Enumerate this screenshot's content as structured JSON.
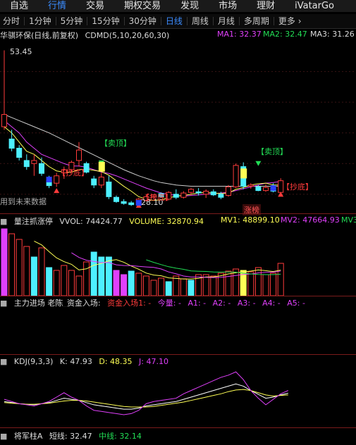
{
  "nav": {
    "items": [
      "自选",
      "行情",
      "交易",
      "期权交易",
      "发现",
      "市场",
      "理财",
      "iVatarGo"
    ],
    "active": 1
  },
  "period_tabs": {
    "items": [
      "分时",
      "1分钟",
      "5分钟",
      "15分钟",
      "30分钟",
      "日线",
      "周线",
      "月线",
      "多周期",
      "更多 ›"
    ],
    "active": 5
  },
  "main": {
    "stock": "华骐环保(日线,前复权)",
    "indicator": "CDMD(5,10,20,60,30)",
    "ma1": "MA1: 32.37",
    "ma2": "MA2: 32.47",
    "ma3": "MA3: 31.26",
    "high_label": "53.45",
    "low_label": "28.10",
    "sell_label": "【卖顶】",
    "buy_label": "【抄底】",
    "future_note": "用到未来数据",
    "limit_up": "涨榜"
  },
  "vol": {
    "title": "量注抓涨停",
    "vvol": "VVOL: 74424.77",
    "volume": "VOLUME: 32870.94",
    "mv1": "MV1: 48899.10",
    "mv2": "MV2: 47664.93",
    "mv3": "MV3"
  },
  "fund": {
    "title": "主力进场 老陈_资金入场:",
    "entry": "资金入场1: -",
    "today": "今量: -",
    "a1": "A1: -",
    "a2": "A2: -",
    "a3": "A3: -",
    "a4": "A4: -",
    "a5": "A5: -"
  },
  "kdj": {
    "title": "KDJ(9,3,3)",
    "k": "K: 47.93",
    "d": "D: 48.35",
    "j": "J: 47.10"
  },
  "general": {
    "title": "将军柱A",
    "short": "短线: 32.47",
    "mid": "中线: 32.14"
  },
  "colors": {
    "up": "#ff3b3b",
    "down": "#4df0ff",
    "magenta": "#e040fb",
    "yellow": "#ffff55",
    "green": "#22dd55",
    "blue_active": "#3b8cff"
  },
  "chart_data": [
    {
      "type": "candlestick",
      "title": "华骐环保(日线,前复权)",
      "candles": [
        {
          "o": 41,
          "h": 53.45,
          "l": 40.5,
          "c": 43
        },
        {
          "o": 39,
          "h": 40.5,
          "l": 37,
          "c": 37.5
        },
        {
          "o": 37.5,
          "h": 38,
          "l": 35.5,
          "c": 36
        },
        {
          "o": 35.5,
          "h": 36.5,
          "l": 34,
          "c": 34.5
        },
        {
          "o": 35,
          "h": 36.5,
          "l": 33,
          "c": 35.5
        },
        {
          "o": 35,
          "h": 36,
          "l": 33,
          "c": 33.4
        },
        {
          "o": 32.2,
          "h": 33,
          "l": 31,
          "c": 31.4
        },
        {
          "o": 31.8,
          "h": 33.5,
          "l": 31.2,
          "c": 33
        },
        {
          "o": 33.5,
          "h": 34.5,
          "l": 32.5,
          "c": 34
        },
        {
          "o": 34,
          "h": 35.5,
          "l": 33.5,
          "c": 35.2
        },
        {
          "o": 35.5,
          "h": 38.5,
          "l": 34.5,
          "c": 37.2
        },
        {
          "o": 35,
          "h": 35.3,
          "l": 33.4,
          "c": 33.6
        },
        {
          "o": 32.5,
          "h": 33,
          "l": 31,
          "c": 31.5
        },
        {
          "o": 31.5,
          "h": 33.5,
          "l": 31,
          "c": 32.8
        },
        {
          "o": 32,
          "h": 33,
          "l": 29.2,
          "c": 29.6
        },
        {
          "o": 29.5,
          "h": 29.8,
          "l": 28.6,
          "c": 28.8
        },
        {
          "o": 28.8,
          "h": 29.2,
          "l": 28.3,
          "c": 28.5
        },
        {
          "o": 28.6,
          "h": 28.9,
          "l": 28.1,
          "c": 28.3
        },
        {
          "o": 28.3,
          "h": 29.4,
          "l": 28.1,
          "c": 29.2
        },
        {
          "o": 29,
          "h": 30,
          "l": 28.8,
          "c": 29.6
        },
        {
          "o": 29.6,
          "h": 30,
          "l": 29.2,
          "c": 29.9
        },
        {
          "o": 30.1,
          "h": 30.3,
          "l": 29.4,
          "c": 29.6
        },
        {
          "o": 29.2,
          "h": 30.5,
          "l": 29,
          "c": 30.3
        },
        {
          "o": 30,
          "h": 30.8,
          "l": 29.2,
          "c": 29.5
        },
        {
          "o": 29.5,
          "h": 30.5,
          "l": 29.3,
          "c": 30.2
        },
        {
          "o": 30.3,
          "h": 31,
          "l": 29.8,
          "c": 30.8
        },
        {
          "o": 30.4,
          "h": 31,
          "l": 29.8,
          "c": 30.2
        },
        {
          "o": 30,
          "h": 30.8,
          "l": 29.4,
          "c": 30.5
        },
        {
          "o": 30.4,
          "h": 30.8,
          "l": 29.7,
          "c": 29.9
        },
        {
          "o": 30,
          "h": 30.4,
          "l": 29.2,
          "c": 29.5
        },
        {
          "o": 29.8,
          "h": 31.5,
          "l": 29.6,
          "c": 31.2
        },
        {
          "o": 31.2,
          "h": 35,
          "l": 31,
          "c": 34.7
        },
        {
          "o": 34.5,
          "h": 35.2,
          "l": 30.8,
          "c": 31.3
        },
        {
          "o": 31.3,
          "h": 31.8,
          "l": 30.9,
          "c": 31.5
        },
        {
          "o": 31.2,
          "h": 31.5,
          "l": 30.5,
          "c": 30.6
        },
        {
          "o": 30.6,
          "h": 31.6,
          "l": 30.4,
          "c": 31.1
        },
        {
          "o": 31,
          "h": 31.8,
          "l": 30.3,
          "c": 30.5
        },
        {
          "o": 30.3,
          "h": 32.6,
          "l": 30.3,
          "c": 32.2
        }
      ],
      "ma1": [
        41,
        40,
        38.5,
        37,
        36.5,
        35.5,
        34.5,
        33.8,
        33.6,
        33.6,
        34,
        34.1,
        33.9,
        33.7,
        33.1,
        32.2,
        31.3,
        30.5,
        29.6,
        29.2,
        29,
        29.1,
        29.4,
        29.7,
        29.8,
        30,
        30.2,
        30.3,
        30.2,
        30.1,
        30.2,
        30.8,
        31.1,
        31.5,
        31.7,
        31.8,
        31.5,
        31.5
      ],
      "ma2": [
        42,
        41,
        40,
        38.5,
        37.5,
        36.5,
        36,
        35.5,
        35,
        34.6,
        34.6,
        34.4,
        34,
        33.6,
        33.4,
        33,
        32.5,
        32,
        31.5,
        31,
        30.6,
        30.2,
        30,
        29.8,
        29.7,
        29.8,
        29.9,
        30,
        30.1,
        30.2,
        30.3,
        30.6,
        30.9,
        31.2,
        31.5,
        31.8,
        31.9,
        32.1
      ],
      "ma3": [
        43,
        42.5,
        42,
        41.5,
        41,
        40.5,
        40,
        39.4,
        38.8,
        38.2,
        37.6,
        37,
        36.4,
        35.8,
        35.2,
        34.6,
        34,
        33.5,
        33,
        32.6,
        32.2,
        31.9,
        31.7,
        31.5,
        31.4,
        31.3,
        31.3,
        31.3,
        31.3,
        31.3,
        31.3,
        31.3,
        31.3,
        31.3,
        31.3,
        31.3,
        31.3,
        31.3
      ]
    },
    {
      "type": "bar",
      "title": "量注抓涨停",
      "values": [
        95,
        88,
        80,
        70,
        55,
        68,
        40,
        36,
        43,
        36,
        28,
        48,
        62,
        55,
        55,
        36,
        30,
        35,
        32,
        28,
        22,
        25,
        20,
        28,
        24,
        22,
        30,
        30,
        28,
        32,
        35,
        38,
        36,
        34,
        40,
        30,
        32,
        46
      ],
      "colors": [
        "magenta",
        "up",
        "up",
        "up",
        "down",
        "up",
        "down",
        "up",
        "up",
        "up",
        "up",
        "up",
        "down",
        "down",
        "down",
        "magenta",
        "magenta",
        "down",
        "up",
        "up",
        "up",
        "up",
        "down",
        "up",
        "up",
        "down",
        "up",
        "up",
        "up",
        "up",
        "up",
        "up",
        "yellow",
        "up",
        "up",
        "up",
        "up",
        "up"
      ]
    },
    {
      "type": "line",
      "title": "KDJ(9,3,3)",
      "k": [
        42,
        40,
        38,
        37,
        36,
        38,
        40,
        44,
        48,
        46,
        44,
        40,
        36,
        34,
        32,
        30,
        28,
        28,
        30,
        34,
        36,
        38,
        40,
        42,
        46,
        50,
        54,
        58,
        62,
        66,
        70,
        74,
        70,
        62,
        55,
        48,
        50,
        54,
        57
      ],
      "d": [
        40,
        39,
        38,
        37,
        37,
        38,
        39,
        41,
        43,
        44,
        44,
        43,
        41,
        39,
        37,
        35,
        33,
        32,
        32,
        32,
        33,
        35,
        37,
        39,
        41,
        44,
        47,
        50,
        53,
        56,
        60,
        63,
        64,
        62,
        58,
        54,
        52,
        53,
        54
      ],
      "j": [
        46,
        42,
        38,
        36,
        34,
        38,
        42,
        50,
        58,
        50,
        44,
        34,
        26,
        24,
        22,
        20,
        18,
        20,
        26,
        38,
        42,
        44,
        46,
        48,
        56,
        62,
        68,
        74,
        80,
        86,
        90,
        96,
        82,
        62,
        48,
        36,
        46,
        56,
        62
      ]
    }
  ]
}
